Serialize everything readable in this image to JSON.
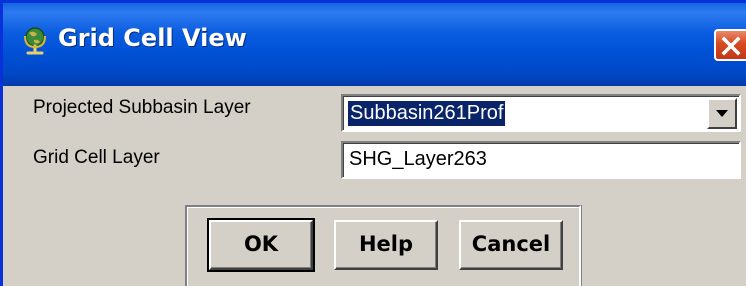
{
  "window": {
    "title": "Grid Cell View",
    "title_icon": "globe-icon",
    "close_icon": "close-icon"
  },
  "fields": {
    "subbasin": {
      "label": "Projected Subbasin Layer",
      "value": "Subbasin261Prof"
    },
    "gridcell": {
      "label": "Grid Cell Layer",
      "value": "SHG_Layer263"
    }
  },
  "buttons": {
    "ok": "OK",
    "help": "Help",
    "cancel": "Cancel"
  },
  "colors": {
    "titlebar": "#0054e3",
    "selection": "#0a246a",
    "close": "#d64a20",
    "face": "#d4d0c8"
  }
}
